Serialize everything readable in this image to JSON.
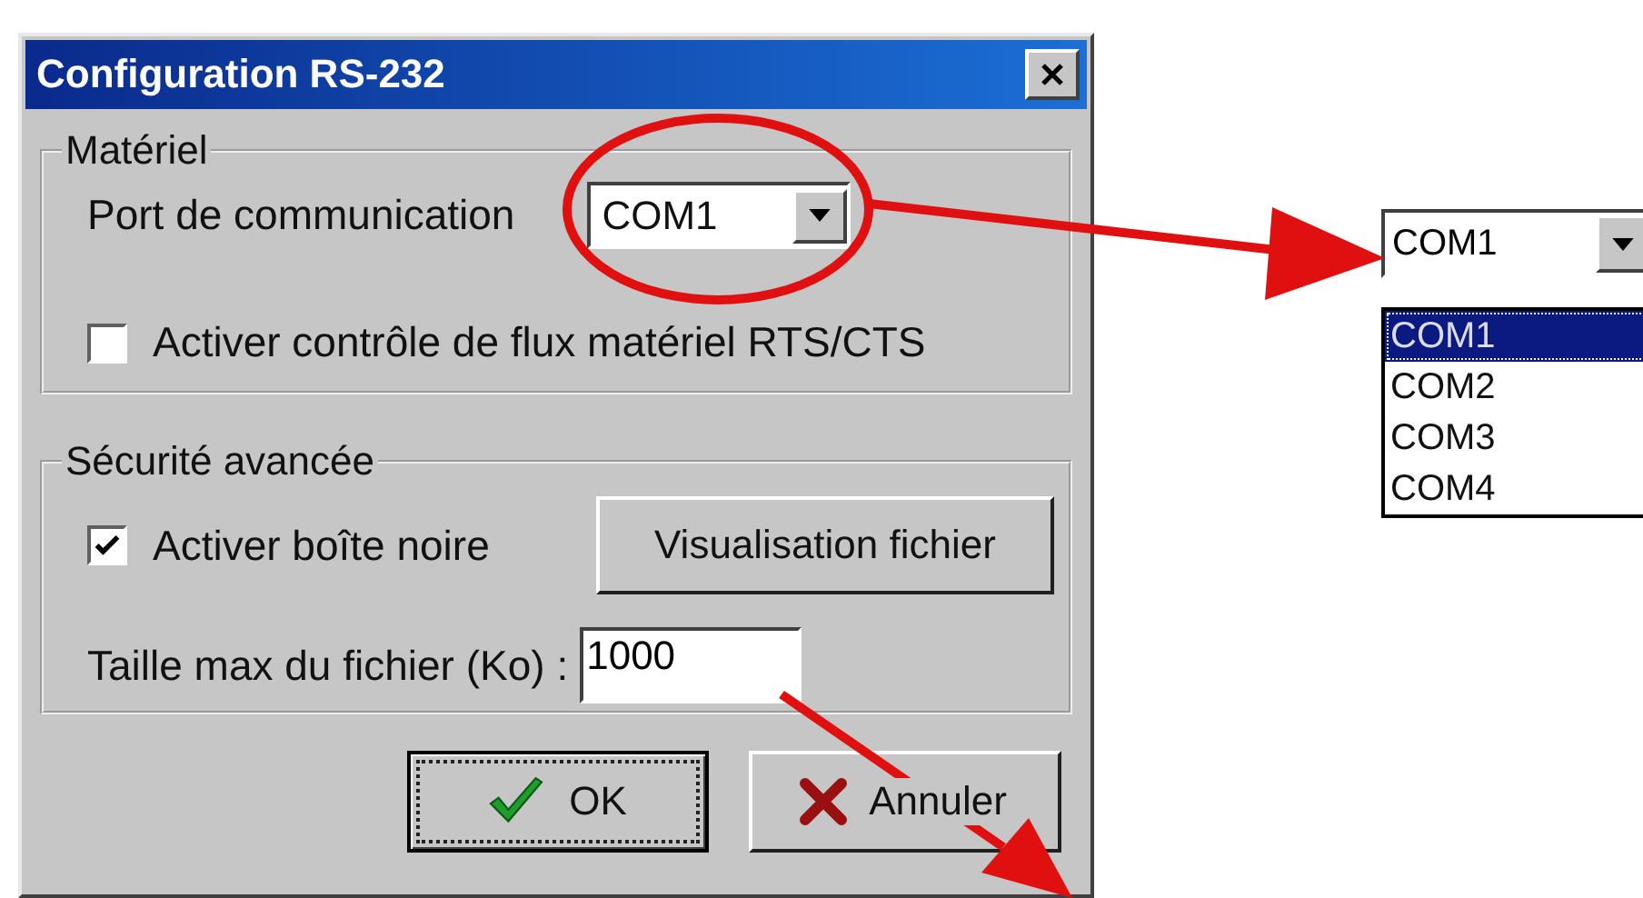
{
  "window": {
    "title": "Configuration RS-232"
  },
  "hardware_group": {
    "label": "Matériel",
    "port_label": "Port de communication",
    "port_value": "COM1",
    "flow_control": {
      "label": "Activer contrôle de flux matériel RTS/CTS",
      "checked": false
    }
  },
  "security_group": {
    "label": "Sécurité avancée",
    "black_box": {
      "label": "Activer boîte noire",
      "checked": true
    },
    "view_button": "Visualisation fichier",
    "size_label": "Taille max du fichier (Ko) :",
    "size_value": "1000"
  },
  "buttons": [
    {
      "label": "OK",
      "kind": "ok",
      "focused": true
    },
    {
      "label": "Annuler",
      "kind": "cancel",
      "focused": false
    }
  ],
  "dropdown_example": {
    "value": "COM1",
    "options": [
      {
        "label": "COM1",
        "selected": true
      },
      {
        "label": "COM2",
        "selected": false
      },
      {
        "label": "COM3",
        "selected": false
      },
      {
        "label": "COM4",
        "selected": false
      }
    ]
  }
}
